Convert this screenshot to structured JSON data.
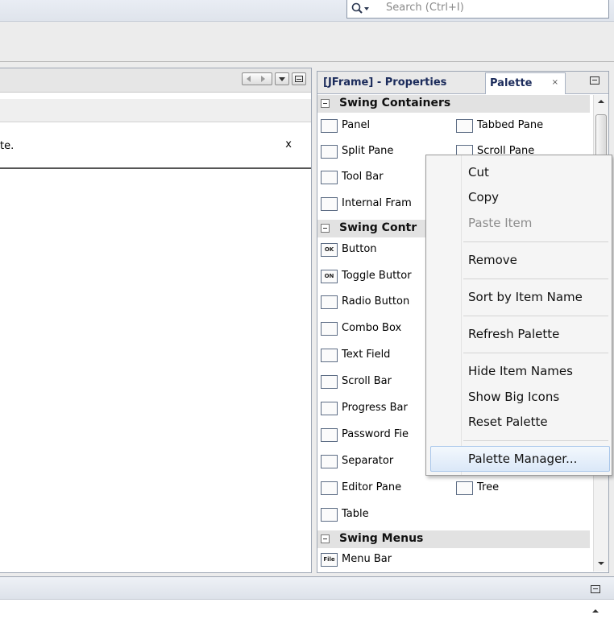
{
  "search": {
    "placeholder": "Search (Ctrl+I)"
  },
  "editor": {
    "message": "te.",
    "close_label": "x"
  },
  "palette": {
    "tabs": [
      {
        "label": "[JFrame] - Properties"
      },
      {
        "label": "Palette",
        "close": "×"
      }
    ],
    "categories": {
      "containers": "Swing Containers",
      "controls": "Swing Contr",
      "menus": "Swing Menus"
    },
    "items": {
      "panel": "Panel",
      "tabbed_pane": "Tabbed Pane",
      "split_pane": "Split Pane",
      "scroll_pane": "Scroll Pane",
      "tool_bar": "Tool Bar",
      "internal_frame": "Internal Fram",
      "button": "Button",
      "toggle_button": "Toggle Buttor",
      "radio_button": "Radio Button",
      "combo_box": "Combo Box",
      "text_field": "Text Field",
      "scroll_bar": "Scroll Bar",
      "progress_bar": "Progress Bar",
      "password_field": "Password Fie",
      "separator": "Separator",
      "editor_pane": "Editor Pane",
      "tree": "Tree",
      "table": "Table",
      "menu_bar": "Menu Bar"
    },
    "icon_text": {
      "button": "OK",
      "toggle": "ON",
      "menu_bar": "File"
    }
  },
  "context_menu": {
    "cut": "Cut",
    "copy": "Copy",
    "paste": "Paste Item",
    "remove": "Remove",
    "sort": "Sort by Item Name",
    "refresh": "Refresh Palette",
    "hide_names": "Hide Item Names",
    "big_icons": "Show Big Icons",
    "reset": "Reset Palette",
    "manager": "Palette Manager..."
  }
}
